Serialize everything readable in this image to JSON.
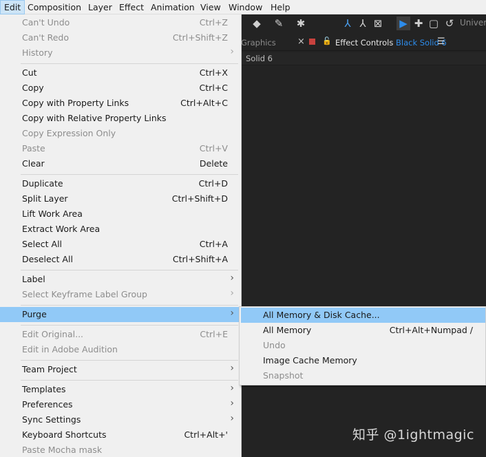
{
  "menubar": [
    "Edit",
    "Composition",
    "Layer",
    "Effect",
    "Animation",
    "View",
    "Window",
    "Help"
  ],
  "panel": {
    "graphics_tab": "Graphics",
    "close": "×",
    "effect_controls_label": "Effect Controls",
    "effect_controls_name": "Black Solid 6",
    "layer_label": "Solid 6",
    "universal_label": "Univers"
  },
  "menu": [
    {
      "label": "Can't Undo",
      "shortcut": "Ctrl+Z",
      "disabled": true
    },
    {
      "label": "Can't Redo",
      "shortcut": "Ctrl+Shift+Z",
      "disabled": true
    },
    {
      "label": "History",
      "shortcut": "",
      "disabled": true,
      "submenu": true
    },
    {
      "label": "Cut",
      "shortcut": "Ctrl+X"
    },
    {
      "label": "Copy",
      "shortcut": "Ctrl+C"
    },
    {
      "label": "Copy with Property Links",
      "shortcut": "Ctrl+Alt+C"
    },
    {
      "label": "Copy with Relative Property Links",
      "shortcut": ""
    },
    {
      "label": "Copy Expression Only",
      "shortcut": "",
      "disabled": true
    },
    {
      "label": "Paste",
      "shortcut": "Ctrl+V",
      "disabled": true
    },
    {
      "label": "Clear",
      "shortcut": "Delete"
    },
    {
      "label": "Duplicate",
      "shortcut": "Ctrl+D"
    },
    {
      "label": "Split Layer",
      "shortcut": "Ctrl+Shift+D"
    },
    {
      "label": "Lift Work Area",
      "shortcut": ""
    },
    {
      "label": "Extract Work Area",
      "shortcut": ""
    },
    {
      "label": "Select All",
      "shortcut": "Ctrl+A"
    },
    {
      "label": "Deselect All",
      "shortcut": "Ctrl+Shift+A"
    },
    {
      "label": "Label",
      "shortcut": "",
      "submenu": true
    },
    {
      "label": "Select Keyframe Label Group",
      "shortcut": "",
      "disabled": true,
      "submenu": true
    },
    {
      "label": "Purge",
      "shortcut": "",
      "submenu": true,
      "highlighted": true
    },
    {
      "label": "Edit Original...",
      "shortcut": "Ctrl+E",
      "disabled": true
    },
    {
      "label": "Edit in Adobe Audition",
      "shortcut": "",
      "disabled": true
    },
    {
      "label": "Team Project",
      "shortcut": "",
      "submenu": true
    },
    {
      "label": "Templates",
      "shortcut": "",
      "submenu": true
    },
    {
      "label": "Preferences",
      "shortcut": "",
      "submenu": true
    },
    {
      "label": "Sync Settings",
      "shortcut": "",
      "submenu": true
    },
    {
      "label": "Keyboard Shortcuts",
      "shortcut": "Ctrl+Alt+'"
    },
    {
      "label": "Paste Mocha mask",
      "shortcut": "",
      "disabled": true
    }
  ],
  "submenu": [
    {
      "label": "All Memory & Disk Cache...",
      "shortcut": "",
      "highlighted": true
    },
    {
      "label": "All Memory",
      "shortcut": "Ctrl+Alt+Numpad /"
    },
    {
      "label": "Undo",
      "shortcut": "",
      "disabled": true
    },
    {
      "label": "Image Cache Memory",
      "shortcut": ""
    },
    {
      "label": "Snapshot",
      "shortcut": "",
      "disabled": true
    }
  ],
  "watermark": "知乎 @1ightmagic",
  "colors": {
    "highlight": "#91c9f7",
    "menu_bg": "#f0f0f0",
    "app_bg": "#232323",
    "accent": "#2d8ceb"
  }
}
